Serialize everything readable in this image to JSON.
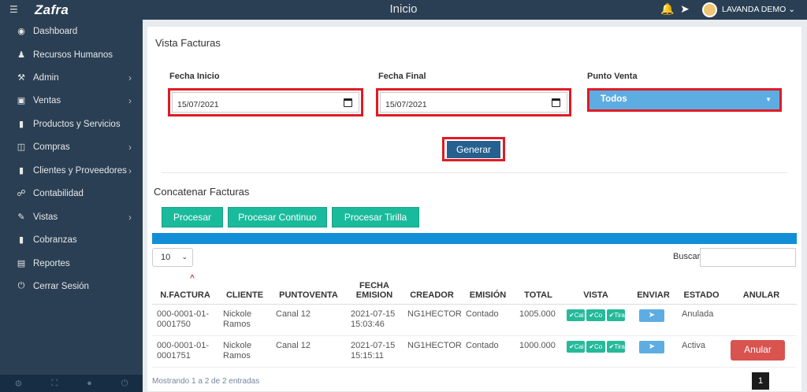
{
  "topbar": {
    "menu_icon": "list-icon",
    "logo": "Zafra",
    "page_title": "Inicio",
    "user_name": "LAVANDA DEMO ⌄"
  },
  "sidebar": {
    "items": [
      {
        "label": "Dashboard",
        "icon": "dashboard-icon",
        "has_children": false
      },
      {
        "label": "Recursos Humanos",
        "icon": "user-icon",
        "has_children": false
      },
      {
        "label": "Admin",
        "icon": "wrench-icon",
        "has_children": true
      },
      {
        "label": "Ventas",
        "icon": "money-icon",
        "has_children": true
      },
      {
        "label": "Productos y Servicios",
        "icon": "book-icon",
        "has_children": false
      },
      {
        "label": "Compras",
        "icon": "cart-icon",
        "has_children": true
      },
      {
        "label": "Clientes y Proveedores",
        "icon": "book-icon",
        "has_children": true
      },
      {
        "label": "Contabilidad",
        "icon": "paperclip-icon",
        "has_children": false
      },
      {
        "label": "Vistas",
        "icon": "edit-icon",
        "has_children": true
      },
      {
        "label": "Cobranzas",
        "icon": "book-icon",
        "has_children": false
      },
      {
        "label": "Reportes",
        "icon": "list-alt-icon",
        "has_children": false
      },
      {
        "label": "Cerrar Sesión",
        "icon": "power-icon",
        "has_children": false
      }
    ]
  },
  "main": {
    "title": "Vista Facturas",
    "fecha_inicio": {
      "label": "Fecha Inicio",
      "value": "15/07/2021"
    },
    "fecha_final": {
      "label": "Fecha Final",
      "value": "15/07/2021"
    },
    "punto_venta": {
      "label": "Punto Venta",
      "value": "Todos"
    },
    "generar_label": "Generar",
    "concat_title": "Concatenar Facturas",
    "buttons": {
      "procesar": "Procesar",
      "procesar_continuo": "Procesar Continuo",
      "procesar_tirilla": "Procesar Tirilla"
    },
    "page_length": "10",
    "search_label": "Buscar:",
    "columns": [
      "N.FACTURA",
      "CLIENTE",
      "PUNTOVENTA",
      "FECHA EMISION",
      "CREADOR",
      "EMISIÓN",
      "TOTAL",
      "VISTA",
      "ENVIAR",
      "ESTADO",
      "ANULAR"
    ],
    "rows": [
      {
        "factura": "000-0001-01-0001750",
        "cliente": "Nickole Ramos",
        "puntoventa": "Canal 12",
        "fecha": "2021-07-15 15:03:46",
        "creador": "NG1HECTOR",
        "emision": "Contado",
        "total": "1005.000",
        "estado": "Anulada",
        "anular": ""
      },
      {
        "factura": "000-0001-01-0001751",
        "cliente": "Nickole Ramos",
        "puntoventa": "Canal 12",
        "fecha": "2021-07-15 15:15:11",
        "creador": "NG1HECTOR",
        "emision": "Contado",
        "total": "1000.000",
        "estado": "Activa",
        "anular": "Anular"
      }
    ],
    "vista_buttons": [
      "✔Cai",
      "✔Co",
      "✔Tira"
    ],
    "info": "Mostrando 1 a 2 de 2 entradas",
    "current_page": "1"
  },
  "colors": {
    "sidebar_bg": "#2a3f54",
    "accent_green": "#1abb9c",
    "highlight_red": "#e01b24",
    "generate_blue": "#26608f",
    "select_blue": "#5dade2",
    "danger": "#d9534f"
  }
}
